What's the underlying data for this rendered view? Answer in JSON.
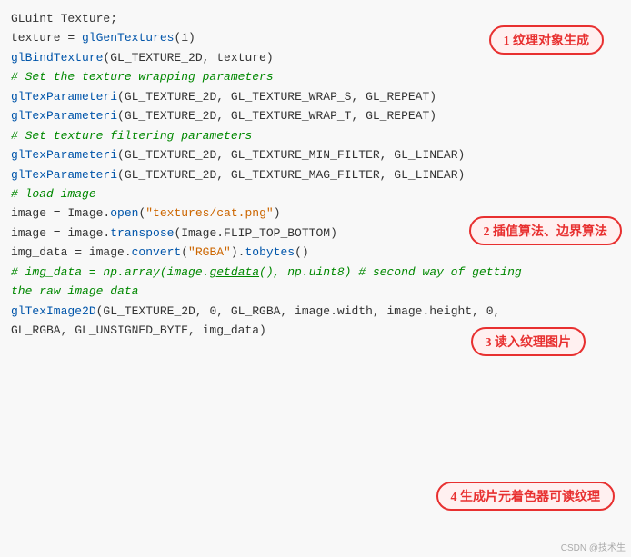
{
  "bubbles": [
    {
      "id": "bubble-1",
      "text": "1 纹理对象生成",
      "class": "bubble-1"
    },
    {
      "id": "bubble-2",
      "text": "2 插值算法、边界算法",
      "class": "bubble-2"
    },
    {
      "id": "bubble-3",
      "text": "3 读入纹理图片",
      "class": "bubble-3"
    },
    {
      "id": "bubble-4",
      "text": "4 生成片元着色器可读纹理",
      "class": "bubble-4"
    }
  ],
  "watermark": "CSDN @技术生"
}
